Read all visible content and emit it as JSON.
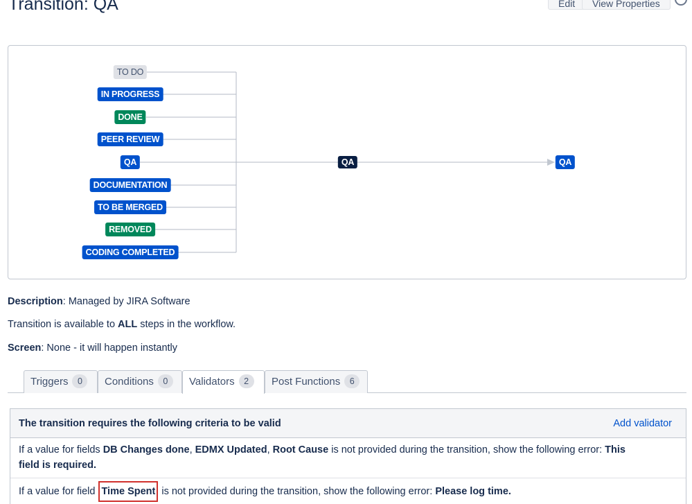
{
  "page": {
    "title": "Transition: QA",
    "edit_label": "Edit",
    "view_properties_label": "View Properties"
  },
  "diagram": {
    "from_statuses": [
      {
        "label": "TO DO",
        "color": "gray"
      },
      {
        "label": "IN PROGRESS",
        "color": "blue"
      },
      {
        "label": "DONE",
        "color": "green"
      },
      {
        "label": "PEER REVIEW",
        "color": "blue"
      },
      {
        "label": "QA",
        "color": "blue"
      },
      {
        "label": "DOCUMENTATION",
        "color": "blue"
      },
      {
        "label": "TO BE MERGED",
        "color": "blue"
      },
      {
        "label": "REMOVED",
        "color": "green"
      },
      {
        "label": "CODING COMPLETED",
        "color": "blue"
      }
    ],
    "transition_label": "QA",
    "target_status": "QA"
  },
  "info": {
    "description_label": "Description",
    "description_value": ": Managed by JIRA Software",
    "availability_prefix": "Transition is available to ",
    "availability_bold": "ALL",
    "availability_suffix": " steps in the workflow.",
    "screen_label": "Screen",
    "screen_value": ": None - it will happen instantly"
  },
  "tabs": [
    {
      "label": "Triggers",
      "count": "0"
    },
    {
      "label": "Conditions",
      "count": "0"
    },
    {
      "label": "Validators",
      "count": "2"
    },
    {
      "label": "Post Functions",
      "count": "6"
    }
  ],
  "validators": {
    "header": "The transition requires the following criteria to be valid",
    "add_label": "Add validator",
    "rule1": {
      "prefix": "If a value for fields ",
      "field1": "DB Changes done",
      "sep1": ", ",
      "field2": "EDMX Updated",
      "sep2": ", ",
      "field3": "Root Cause",
      "middle": " is not provided during the transition, show the following error: ",
      "error": "This field is required."
    },
    "rule2": {
      "prefix": "If a value for field ",
      "field": "Time Spent",
      "middle": " is not provided during the transition, show the following error: ",
      "error": "Please log time."
    }
  },
  "colors": {
    "status_gray": "#dfe1e6",
    "status_blue": "#0052cc",
    "status_green": "#00875a",
    "transition_dark": "#091e42",
    "link_blue": "#0052cc",
    "highlight_red": "#d0312d"
  }
}
